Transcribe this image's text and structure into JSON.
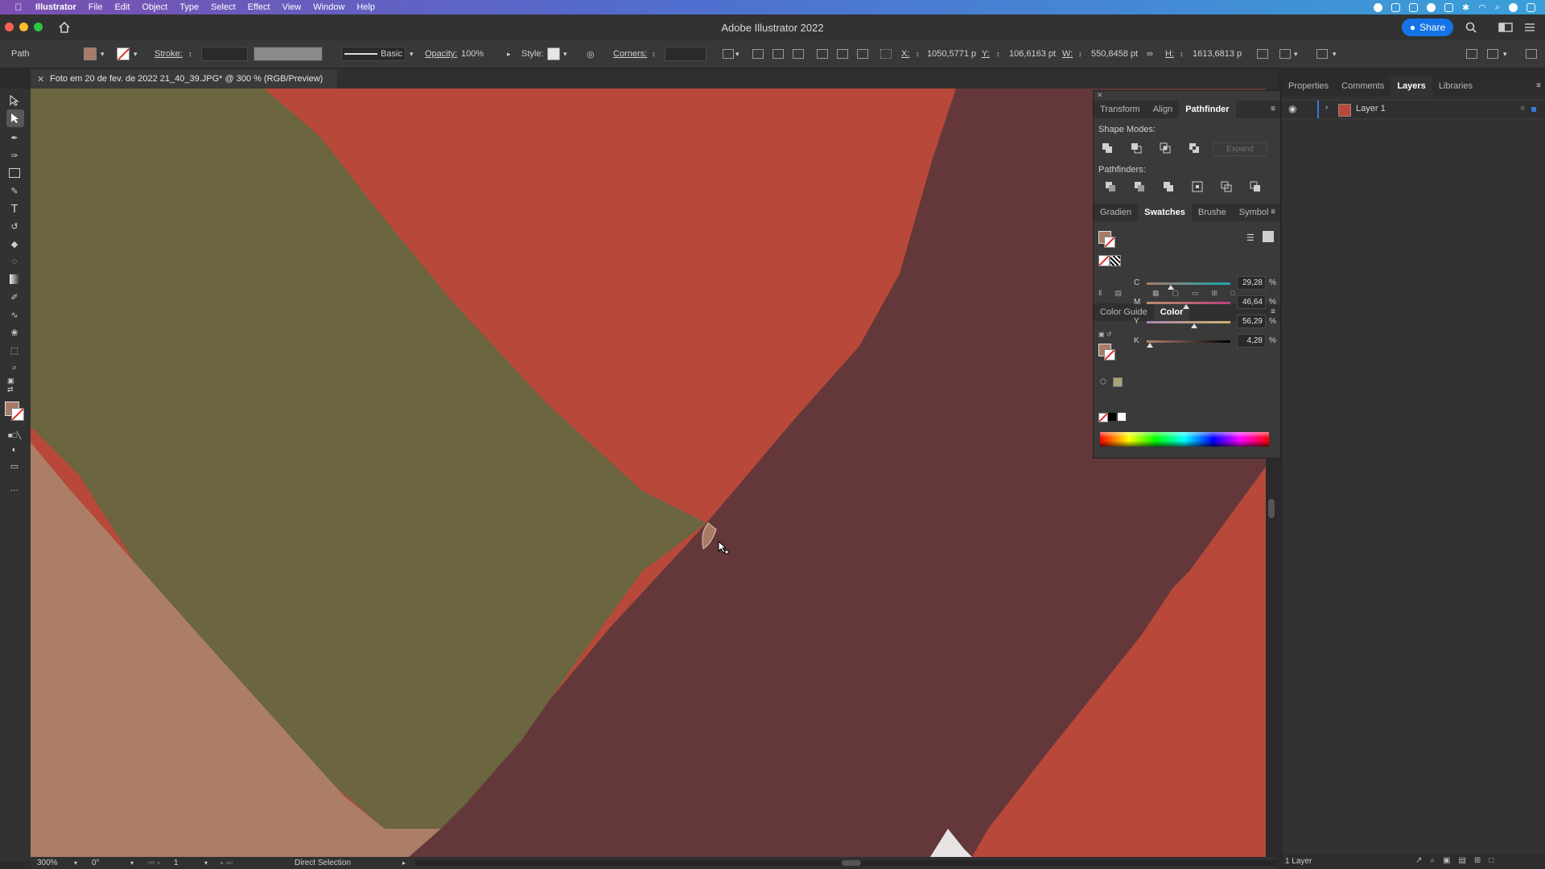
{
  "menubar": {
    "app_name": "Illustrator",
    "items": [
      "File",
      "Edit",
      "Object",
      "Type",
      "Select",
      "Effect",
      "View",
      "Window",
      "Help"
    ]
  },
  "window": {
    "title": "Adobe Illustrator 2022",
    "share_label": "Share"
  },
  "control_bar": {
    "selection_type": "Path",
    "stroke_label": "Stroke:",
    "stroke_profile": "Basic",
    "opacity_label": "Opacity:",
    "opacity_value": "100%",
    "style_label": "Style:",
    "corners_label": "Corners:",
    "x_label": "X:",
    "x_value": "1050,5771 p",
    "y_label": "Y:",
    "y_value": "106,6163 pt",
    "w_label": "W:",
    "w_value": "550,8458 pt",
    "h_label": "H:",
    "h_value": "1613,6813 p",
    "fill_color": "#a77b65"
  },
  "document_tab": {
    "title": "Foto em 20 de fev. de 2022 21_40_39.JPG* @ 300 % (RGB/Preview)"
  },
  "canvas": {
    "colors": {
      "red": "#b8493a",
      "olive": "#6b6540",
      "tan": "#ac7e67",
      "maroon": "#64383a",
      "white": "#e8e4e4"
    }
  },
  "pathfinder_panel": {
    "tabs": [
      "Transform",
      "Align",
      "Pathfinder"
    ],
    "active_tab": "Pathfinder",
    "shape_modes_label": "Shape Modes:",
    "pathfinders_label": "Pathfinders:",
    "expand_label": "Expand"
  },
  "swatches_panel": {
    "tabs": [
      "Gradien",
      "Swatches",
      "Brushe",
      "Symbol"
    ],
    "active_tab": "Swatches"
  },
  "color_panel": {
    "tabs": [
      "Color Guide",
      "Color"
    ],
    "active_tab": "Color",
    "sliders": [
      {
        "label": "C",
        "value": "29,28",
        "fraction": 0.2928,
        "gradient": "linear-gradient(90deg,#a77b65,#1aa6b0)"
      },
      {
        "label": "M",
        "value": "46,64",
        "fraction": 0.4664,
        "gradient": "linear-gradient(90deg,#b9906a,#c03e7a)"
      },
      {
        "label": "Y",
        "value": "56,29",
        "fraction": 0.5629,
        "gradient": "linear-gradient(90deg,#a785b0,#c9b46a)"
      },
      {
        "label": "K",
        "value": "4,28",
        "fraction": 0.0428,
        "gradient": "linear-gradient(90deg,#b08270,#000000)"
      }
    ],
    "unit": "%"
  },
  "right_panel": {
    "tabs": [
      "Properties",
      "Comments",
      "Layers",
      "Libraries"
    ],
    "active_tab": "Layers",
    "layer_name": "Layer 1",
    "status": "1 Layer"
  },
  "status_bar": {
    "zoom": "300%",
    "rotation": "0°",
    "artboard": "1",
    "tool": "Direct Selection"
  }
}
